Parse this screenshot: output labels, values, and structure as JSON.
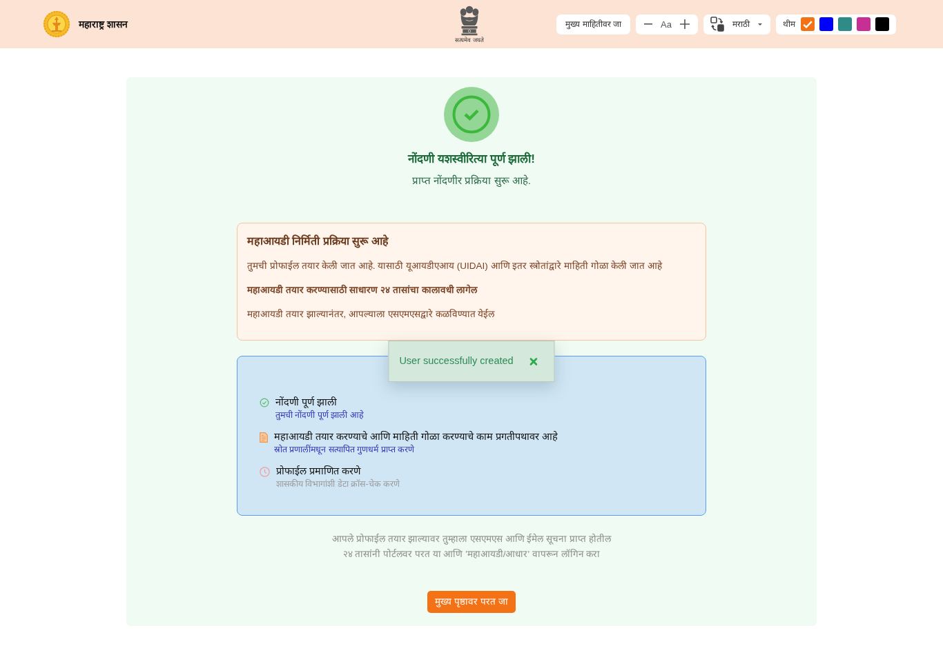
{
  "header": {
    "brand_title": "महाराष्ट्र शासन",
    "emblem_motto": "सत्यमेव जयते",
    "skip_link": "मुख्य माहितीवर जा",
    "font_size": {
      "reset_label": "Aa"
    },
    "language": {
      "label": "मराठी"
    },
    "theme": {
      "label": "थीम",
      "swatches": [
        {
          "color": "#f47216",
          "selected": true
        },
        {
          "color": "#0000ff",
          "selected": false
        },
        {
          "color": "#2e8b87",
          "selected": false
        },
        {
          "color": "#c82f94",
          "selected": false
        },
        {
          "color": "#000000",
          "selected": false
        }
      ]
    }
  },
  "status": {
    "title": "नोंदणी यशस्वीरित्या पूर्ण झाली!",
    "subtitle": "प्राप्त नोंदणीर प्रक्रिया सुरू आहे."
  },
  "notice": {
    "title": "महाआयडी निर्मिती प्रक्रिया सुरू आहे",
    "paragraphs": [
      {
        "kind": "text",
        "text": "तुमची प्रोफाईल तयार केली जात आहे. यासाठी यूआयडीएआय (UIDAI) आणि इतर स्त्रोतांद्वारे माहिती गोळा केली जात आहे"
      },
      {
        "kind": "emphasis",
        "text": "महाआयडी तयार करण्यासाठी साधारण २४ तासांचा कालावधी लागेल"
      },
      {
        "kind": "text",
        "text": "महाआयडी तयार झाल्यानंतर, आपल्याला एसएमएसद्वारे कळविण्यात येईल"
      }
    ]
  },
  "steps": [
    {
      "kind": "done",
      "title": "नोंदणी पूर्ण झाली",
      "detail": "तुमची नोंदणी पूर्ण झाली आहे"
    },
    {
      "kind": "active",
      "title": "महाआयडी तयार करण्याचे आणि माहिती गोळा करण्याचे काम प्रगतीपथावर आहे",
      "detail": "स्रोत प्रणालींमधून सत्यापित गुणधर्म प्राप्त करणे"
    },
    {
      "kind": "pending",
      "title": "प्रोफाईल प्रमाणित करणे",
      "detail": "शासकीय विभागांशी डेटा क्रॉस-चेक करणे"
    }
  ],
  "footnote": [
    "आपले प्रोफाईल तयार झाल्यावर तुम्हाला एसएमएस आणि ईमेल सूचना प्राप्त होतील",
    "२४ तासांनी पोर्टलवर परत या आणि 'महाआयडी/आधार' वापरून लॉगिन करा"
  ],
  "home_button": "मुख्य पृष्ठावर परत जा",
  "toast": {
    "message": "User successfully created"
  }
}
